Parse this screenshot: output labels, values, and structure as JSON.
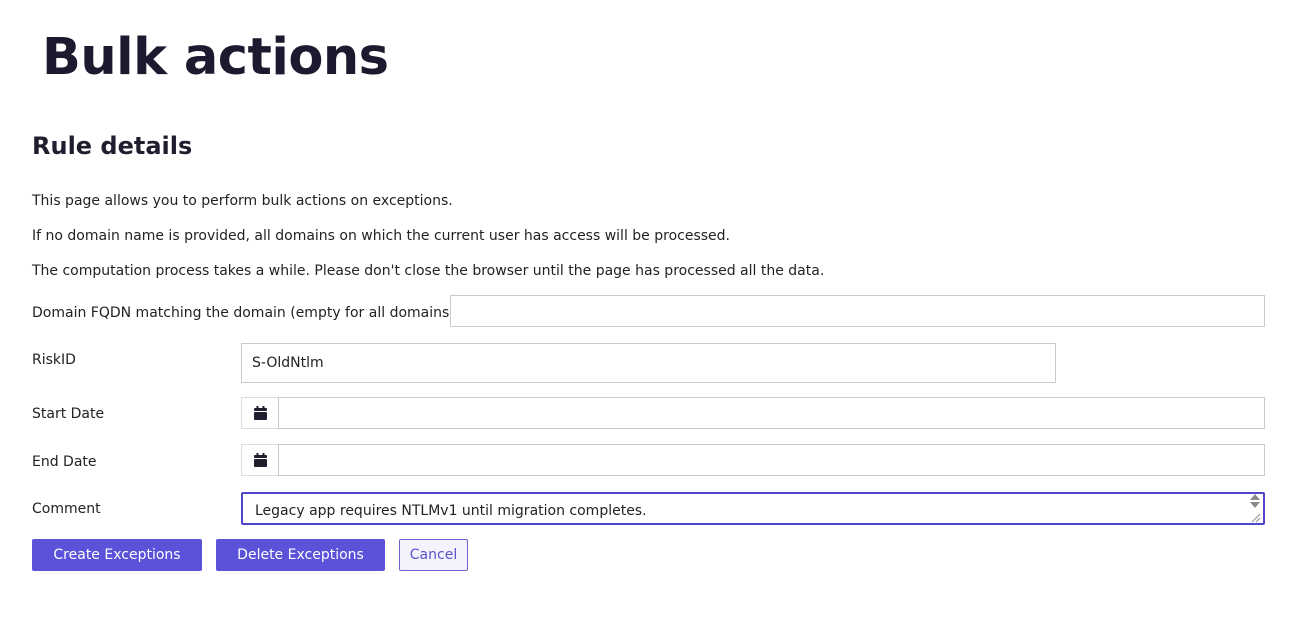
{
  "header": {
    "title": "Bulk actions"
  },
  "section": {
    "title": "Rule details"
  },
  "info": {
    "line1": "This page allows you to perform bulk actions on exceptions.",
    "line2": "If no domain name is provided, all domains on which the current user has access will be processed.",
    "line3": "The computation process takes a while. Please don't close the browser until the page has processed all the data."
  },
  "form": {
    "domain": {
      "label": "Domain FQDN matching the domain (empty for all domains)",
      "value": ""
    },
    "risk_id": {
      "label": "RiskID",
      "value": "S-OldNtlm"
    },
    "start_date": {
      "label": "Start Date",
      "value": "",
      "icon": "calendar-icon"
    },
    "end_date": {
      "label": "End Date",
      "value": "",
      "icon": "calendar-icon"
    },
    "comment": {
      "label": "Comment",
      "value": "Legacy app requires NTLMv1 until migration completes."
    }
  },
  "actions": {
    "create_label": "Create Exceptions",
    "delete_label": "Delete Exceptions",
    "cancel_label": "Cancel"
  },
  "colors": {
    "primary": "#5a52d8",
    "focus_border": "#5046c9",
    "secondary_text": "#5b53c8",
    "title": "#1b1a2e"
  }
}
